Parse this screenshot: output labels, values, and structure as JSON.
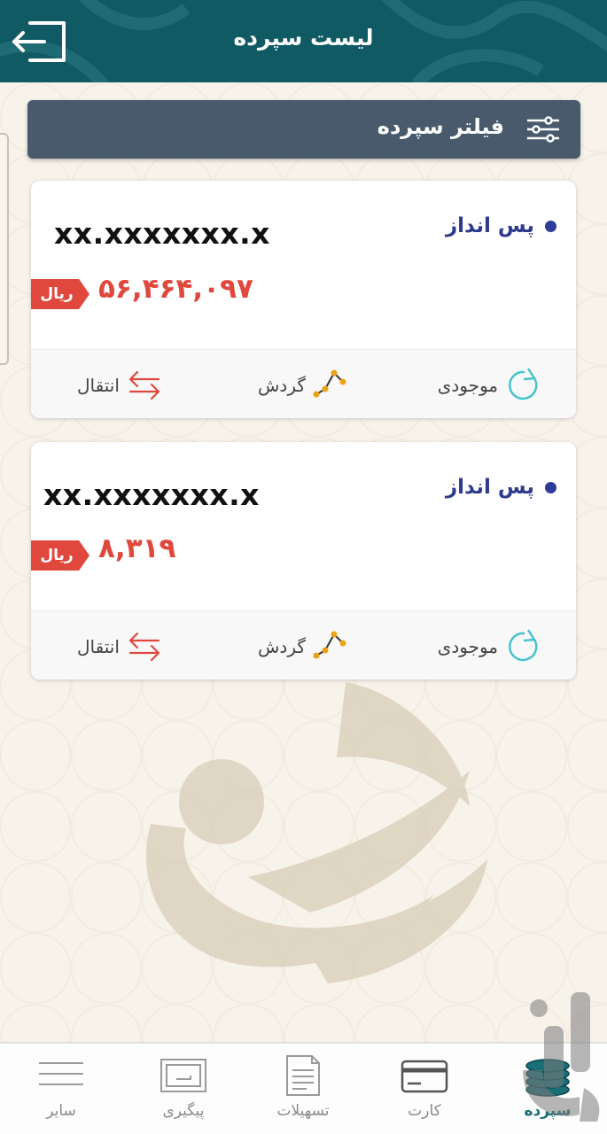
{
  "header": {
    "title": "لیست سپرده",
    "back_icon": "logout-arrow-icon",
    "bg_color": "#0f5a63"
  },
  "filter": {
    "label": "فیلتر سپرده",
    "icon": "sliders-icon"
  },
  "accounts": [
    {
      "type": "پس انداز",
      "number": "xx.xxxxxxx.x",
      "currency": "ریال",
      "amount": "۵۶,۴۶۴,۰۹۷"
    },
    {
      "type": "پس انداز",
      "number": "xx.xxxxxxx.x",
      "currency": "ریال",
      "amount": "۸,۳۱۹"
    }
  ],
  "actions": {
    "balance": "موجودی",
    "turnover": "گردش",
    "transfer": "انتقال"
  },
  "nav": {
    "deposit": "سپرده",
    "card": "کارت",
    "facilities": "تسهیلات",
    "tracking": "پیگیری",
    "others": "سایر"
  },
  "colors": {
    "accent": "#e0483e",
    "primary": "#0f5a63",
    "filter_bar": "#485a6b",
    "account_type": "#2e3a8c"
  }
}
